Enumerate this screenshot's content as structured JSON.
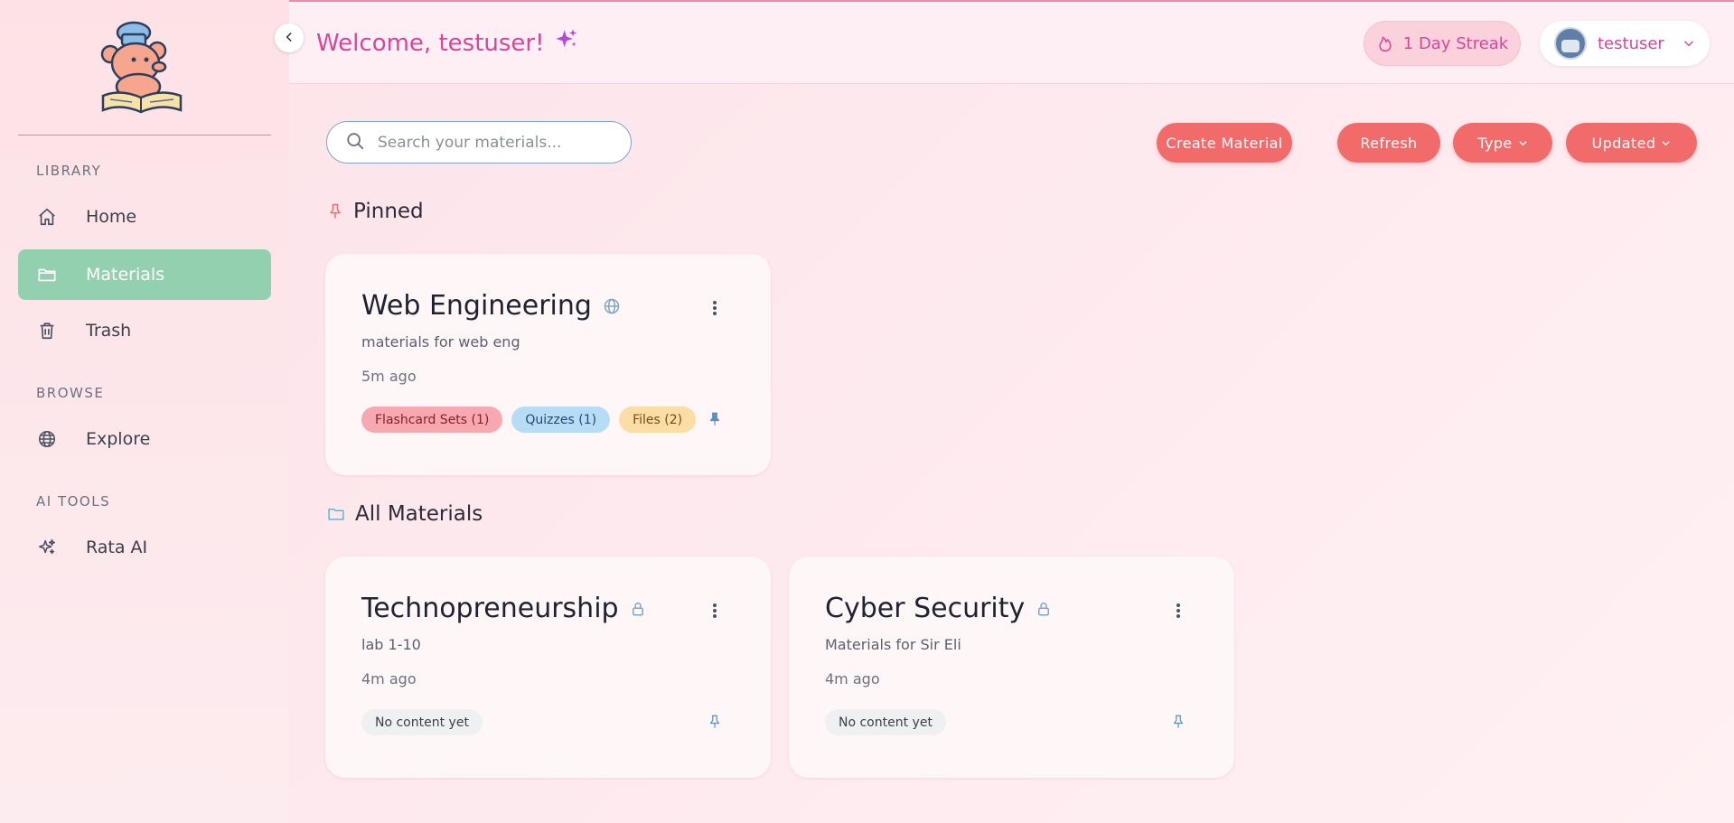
{
  "header": {
    "welcome_text": "Welcome, testuser!",
    "streak_label": "1 Day Streak",
    "username": "testuser"
  },
  "sidebar": {
    "sections": [
      {
        "title": "LIBRARY"
      },
      {
        "title": "BROWSE"
      },
      {
        "title": "AI TOOLS"
      }
    ],
    "items": [
      {
        "label": "Home",
        "icon": "home-icon"
      },
      {
        "label": "Materials",
        "icon": "folder-icon",
        "active": true
      },
      {
        "label": "Trash",
        "icon": "trash-icon"
      },
      {
        "label": "Explore",
        "icon": "globe-icon"
      },
      {
        "label": "Rata AI",
        "icon": "sparkles-icon"
      }
    ]
  },
  "toolbar": {
    "search_placeholder": "Search your materials...",
    "create_label": "Create Material",
    "refresh_label": "Refresh",
    "type_label": "Type",
    "updated_label": "Updated"
  },
  "sections": {
    "pinned": "Pinned",
    "all": "All Materials"
  },
  "cards": [
    {
      "title": "Web Engineering",
      "visibility": "globe-icon",
      "description": "materials for web eng",
      "time": "5m ago",
      "chips": [
        "Flashcard Sets (1)",
        "Quizzes (1)",
        "Files (2)"
      ],
      "pinned": true
    },
    {
      "title": "Technopreneurship",
      "visibility": "lock-icon",
      "description": "lab 1-10",
      "time": "4m ago",
      "chips": [
        "No content yet"
      ],
      "pinned": false
    },
    {
      "title": "Cyber Security",
      "visibility": "lock-icon",
      "description": "Materials for Sir Eli",
      "time": "4m ago",
      "chips": [
        "No content yet"
      ],
      "pinned": false
    }
  ],
  "colors": {
    "accent_pink": "#d9459a",
    "button_coral": "#f26b6b",
    "active_green": "#93d0b0",
    "chip_flashcard": "#f7a8b0",
    "chip_quiz": "#b7dcf6",
    "chip_files": "#fbdda5"
  }
}
